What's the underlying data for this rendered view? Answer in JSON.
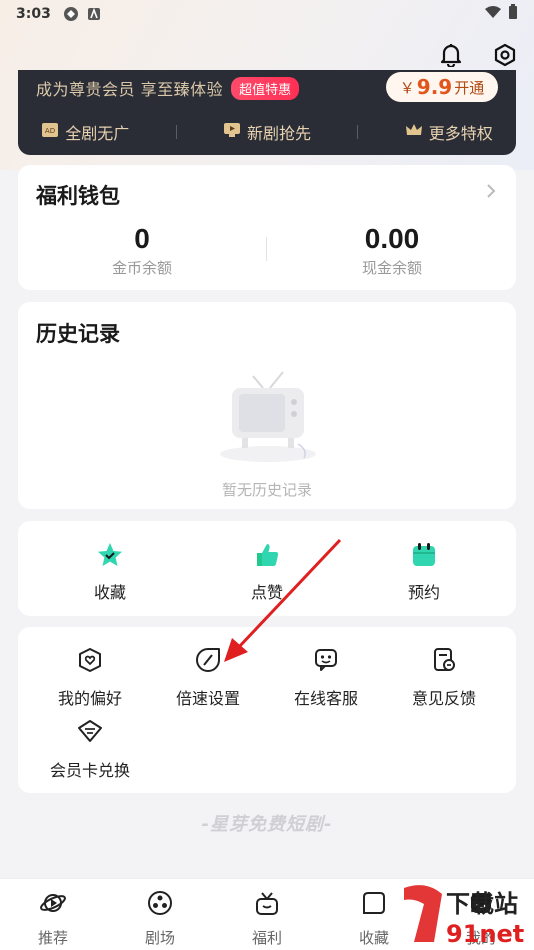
{
  "status_bar": {
    "time": "3:03"
  },
  "vip": {
    "slogan": "成为尊贵会员 享至臻体验",
    "badge": "超值特惠",
    "currency": "￥",
    "price": "9.9",
    "open_label": "开通",
    "perks": [
      "全剧无广",
      "新剧抢先",
      "更多特权"
    ]
  },
  "wallet": {
    "title": "福利钱包",
    "coins_value": "0",
    "coins_label": "金币余额",
    "cash_value": "0.00",
    "cash_label": "现金余额"
  },
  "history": {
    "title": "历史记录",
    "empty_text": "暂无历史记录"
  },
  "quick_actions": [
    {
      "label": "收藏",
      "icon": "star-icon",
      "color": "#2fd6b0"
    },
    {
      "label": "点赞",
      "icon": "thumb-icon",
      "color": "#22c98f"
    },
    {
      "label": "预约",
      "icon": "calendar-icon",
      "color": "#2fd6b0"
    }
  ],
  "tools": [
    {
      "label": "我的偏好",
      "icon": "heart-shield-icon"
    },
    {
      "label": "倍速设置",
      "icon": "speed-icon"
    },
    {
      "label": "在线客服",
      "icon": "chat-bot-icon"
    },
    {
      "label": "意见反馈",
      "icon": "feedback-icon"
    },
    {
      "label": "会员卡兑换",
      "icon": "vip-card-icon"
    }
  ],
  "brand_footer": "-星芽免费短剧-",
  "tabbar": [
    {
      "label": "推荐",
      "icon": "planet-icon"
    },
    {
      "label": "剧场",
      "icon": "film-reel-icon"
    },
    {
      "label": "福利",
      "icon": "gift-icon"
    },
    {
      "label": "收藏",
      "icon": "folder-icon"
    },
    {
      "label": "我的",
      "icon": "profile-icon"
    }
  ],
  "watermark": {
    "text1": "下载站",
    "text2": "91net"
  },
  "colors": {
    "accent": "#e0561c",
    "vip_dark": "#2b2d36",
    "teal": "#2fd6b0",
    "arrow": "#e02020"
  }
}
